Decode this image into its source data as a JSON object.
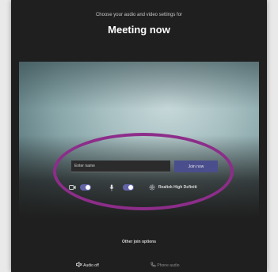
{
  "header": {
    "subtitle": "Choose your audio and video settings for",
    "title": "Meeting now"
  },
  "join_form": {
    "name_placeholder": "Enter name",
    "join_label": "Join now"
  },
  "controls": {
    "camera_toggle": "on",
    "mic_toggle": "on",
    "device_label": "Realtek High Definiti"
  },
  "footer": {
    "other_options_label": "Other join options",
    "audio_off_label": "Audio off",
    "phone_audio_label": "Phone audio"
  },
  "colors": {
    "background": "#1f1f1f",
    "accent": "#6264a7",
    "highlight": "#8d2d8a"
  },
  "icons": [
    "camera-icon",
    "microphone-icon",
    "gear-icon",
    "speaker-icon",
    "phone-icon"
  ]
}
